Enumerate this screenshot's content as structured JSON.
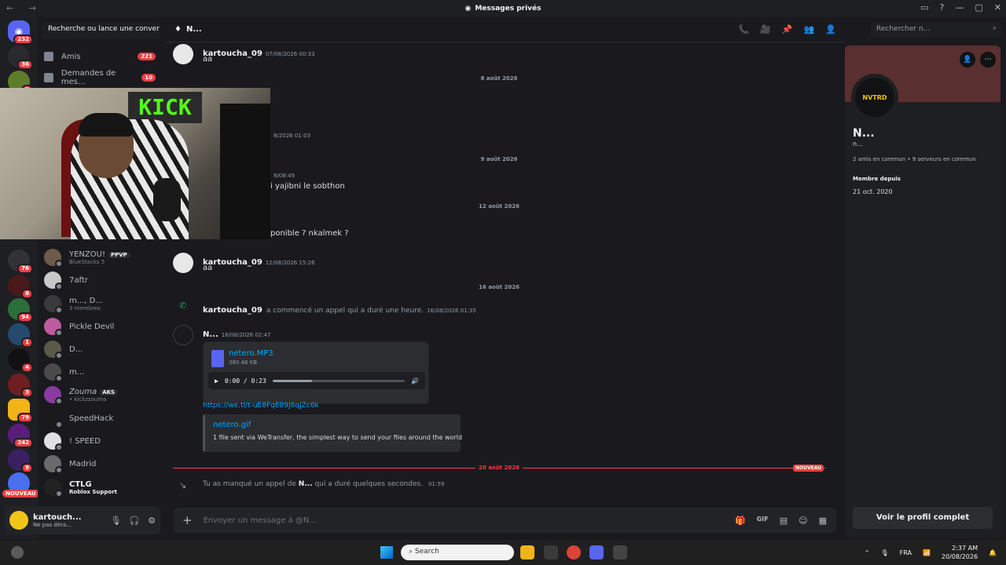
{
  "window": {
    "title": "Messages privés",
    "nav_arrows": "← →",
    "controls": {
      "inbox": "▭",
      "help": "?",
      "minimize": "—",
      "maximize": "▢",
      "close": "✕"
    }
  },
  "servers": {
    "home_badge": "232",
    "badges": [
      "36",
      "1",
      "76",
      "8",
      "94",
      "1",
      "4",
      "3",
      "79",
      "242",
      "9"
    ],
    "new_label": "NOUVEAU"
  },
  "dm_sidebar": {
    "search_label": "Recherche ou lance une conver...",
    "nav": [
      {
        "label": "Amis",
        "count": "221"
      },
      {
        "label": "Demandes de mes...",
        "count": "10"
      }
    ],
    "dms": [
      {
        "name": "YENZOU!",
        "tag": "PPVP",
        "sub": "BlueStacks 5"
      },
      {
        "name": "7aftr",
        "sub": ""
      },
      {
        "name": "m..., D...",
        "sub": "3 membres"
      },
      {
        "name": "Pickle Devil",
        "sub": ""
      },
      {
        "name": "D...",
        "sub": ""
      },
      {
        "name": "m...",
        "sub": ""
      },
      {
        "name": "Zouma",
        "tag": "AKS",
        "sub": "• kickzzouma"
      },
      {
        "name": "SpeedHack",
        "sub": ""
      },
      {
        "name": "! SPEED",
        "sub": ""
      },
      {
        "name": "Madrid",
        "sub": ""
      },
      {
        "name": "CTLG",
        "sub": "Roblox Support"
      }
    ]
  },
  "user_panel": {
    "name": "kartouch...",
    "status": "Ne pas déra...",
    "mic_icon": "🎙",
    "headset_icon": "🎧",
    "settings_icon": "⚙"
  },
  "webcam": {
    "sign": "KICK"
  },
  "chat_header": {
    "title": "N...",
    "icons": [
      "📞",
      "🎥",
      "📌",
      "👥",
      "👤"
    ],
    "search_placeholder": "Rechercher n...",
    "search_icon": "⌕"
  },
  "messages": {
    "m1": {
      "author": "kartoucha_09",
      "time": "07/08/2026 00:33",
      "text": "aa"
    },
    "d1": "8 août 2026",
    "m2_time": "8/2026 01:03",
    "d2": "9 août 2026",
    "m3_time": "8/08:49",
    "m3_text": "i yajibni le sobthon",
    "d3": "12 août 2026",
    "m4_text": "ponible ? nkalmek ?",
    "m5": {
      "author": "kartoucha_09",
      "time": "12/08/2026 15:26",
      "text": "aa"
    },
    "d4": "16 août 2026",
    "call": {
      "author": "kartoucha_09",
      "text": "a commencé un appel qui a duré une heure.",
      "time": "16/08/2026 01:35"
    },
    "m6": {
      "author": "N...",
      "time": "16/08/2026 02:47"
    },
    "attachment": {
      "name": "netero.MP3",
      "size": "360.46 KB",
      "time": "0:00 / 0:23",
      "progress": 0.3
    },
    "link": "https://we.tl/t-uE8FqE89J8qjZc6k",
    "embed": {
      "title": "netero.gif",
      "desc": "1 file sent via WeTransfer, the simplest way to send your files around the world"
    },
    "d5": "20 août 2026",
    "new_tag": "NOUVEAU",
    "missed": {
      "pre": "Tu as manqué un appel de",
      "name": "N...",
      "post": "qui a duré quelques secondes.",
      "time": "01:59"
    }
  },
  "composer": {
    "placeholder": "Envoyer un message à @N...",
    "plus": "+",
    "tools": [
      "🎁",
      "GIF",
      "▤",
      "☺",
      "▦"
    ]
  },
  "profile": {
    "name": "N...",
    "username": "n...",
    "avatar_text": "NVTRD",
    "mutual": "2 amis en commun • 9 serveurs en commun",
    "member_since_label": "Membre depuis",
    "member_since": "21 oct. 2020",
    "full_profile_button": "Voir le profil complet"
  },
  "taskbar": {
    "search": "Search",
    "lang": "FRA",
    "time": "2:37 AM",
    "date": "20/08/2026"
  }
}
